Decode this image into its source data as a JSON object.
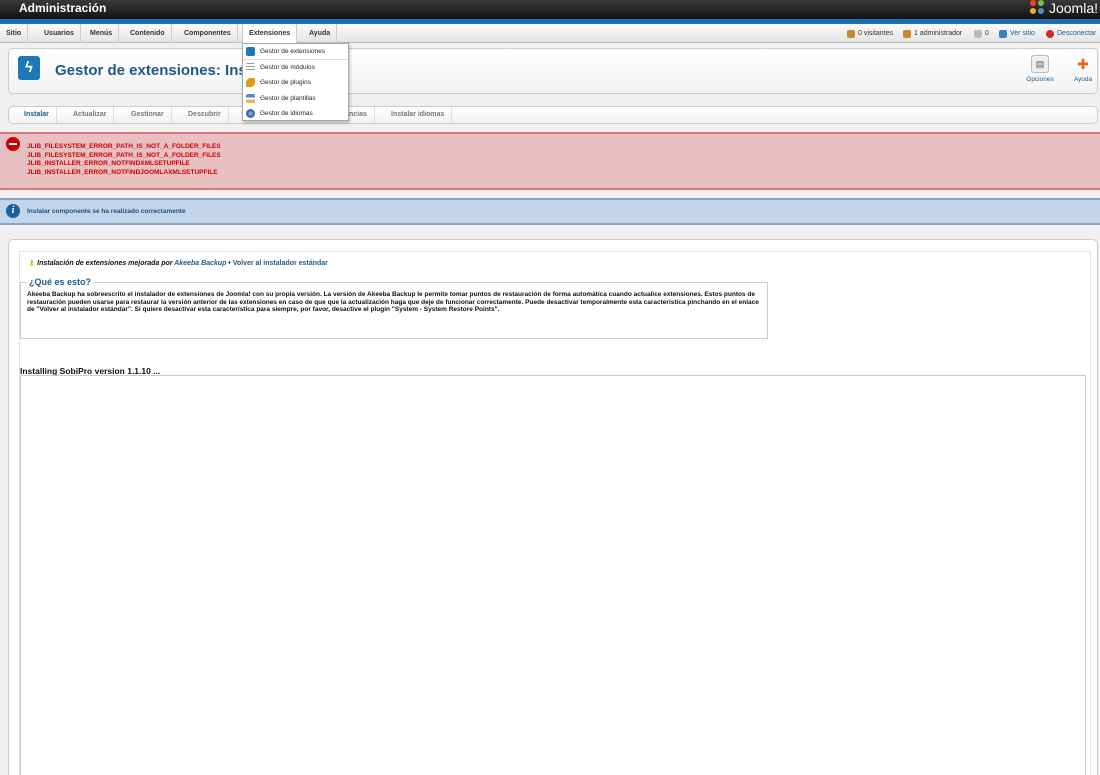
{
  "header": {
    "title": "Administración",
    "logo_text": "Joomla!"
  },
  "menubar": {
    "items": [
      {
        "label": "Sitio"
      },
      {
        "label": "Usuarios"
      },
      {
        "label": "Menús"
      },
      {
        "label": "Contenido"
      },
      {
        "label": "Componentes"
      },
      {
        "label": "Extensiones"
      },
      {
        "label": "Ayuda"
      }
    ],
    "status": {
      "visitors": "0 visitantes",
      "admins": "1 administrador",
      "messages": "0",
      "view_site": "Ver sitio",
      "logout": "Desconectar"
    }
  },
  "dropdown": {
    "items": [
      {
        "label": "Gestor de extensiones",
        "icon": "extensions-icon",
        "color": "#1f78b6"
      },
      {
        "label": "Gestor de módulos",
        "icon": "modules-icon",
        "color": "#888888"
      },
      {
        "label": "Gestor de plugins",
        "icon": "plugins-icon",
        "color": "#e39a19"
      },
      {
        "label": "Gestor de plantillas",
        "icon": "templates-icon",
        "color": "#4a90c8"
      },
      {
        "label": "Gestor de idiomas",
        "icon": "languages-icon",
        "color": "#3b6fb5"
      }
    ]
  },
  "toolbar": {
    "title": "Gestor de extensiones: Instalar",
    "options_label": "Opciones",
    "help_label": "Ayuda"
  },
  "subnav": {
    "tabs": [
      {
        "label": "Instalar"
      },
      {
        "label": "Actualizar"
      },
      {
        "label": "Gestionar"
      },
      {
        "label": "Descubrir"
      },
      {
        "label": "ncias"
      },
      {
        "label": "Instalar idiomas"
      }
    ]
  },
  "errors": [
    "JLIB_FILESYSTEM_ERROR_PATH_IS_NOT_A_FOLDER_FILES",
    "JLIB_FILESYSTEM_ERROR_PATH_IS_NOT_A_FOLDER_FILES",
    "JLIB_INSTALLER_ERROR_NOTFINDXMLSETUPFILE",
    "JLIB_INSTALLER_ERROR_NOTFINDJOOMLAXMLSETUPFILE"
  ],
  "info_message": "Instalar componente se ha realizado correctamente",
  "akeeba": {
    "intro": "Instalación de extensiones mejorada por",
    "brand": "Akeeba Backup",
    "separator": " • ",
    "back_link": "Volver al instalador estándar",
    "legend": "¿Qué es esto?",
    "description": "Akeeba Backup ha sobreescrito el instalador de extensiones de Joomla! con su propia versión. La versión de Akeeba Backup le permite tomar puntos de restauración de forma automática cuando actualice extensiones. Estos puntos de restauración pueden usarse para restaurar la versión anterior de las extensiones en caso de que que la actualización haga que deje de funcionar correctamente. Puede desactivar temporalmente esta característica pinchando en el enlace de \"Volver al instalador estándar\". Si quiere desactivar esta característica para siempre, por favor, desactive el plugin \"System - System Restore Points\"."
  },
  "installing_text": "Installing SobiPro version 1.1.10 ..."
}
